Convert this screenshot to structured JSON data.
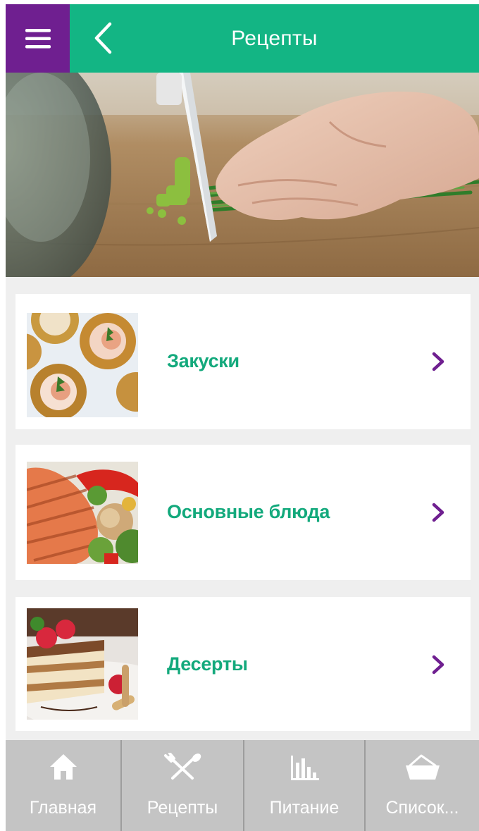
{
  "header": {
    "title": "Рецепты",
    "accent_color": "#13b584",
    "menu_color": "#6f1f90",
    "menu_icon": "hamburger-icon",
    "back_icon": "chevron-left-icon"
  },
  "categories": [
    {
      "label": "Закуски",
      "image": "appetizers-photo",
      "icon": "chevron-right-icon"
    },
    {
      "label": "Основные блюда",
      "image": "main-courses-photo",
      "icon": "chevron-right-icon"
    },
    {
      "label": "Десерты",
      "image": "desserts-photo",
      "icon": "chevron-right-icon"
    }
  ],
  "tabbar": {
    "items": [
      {
        "label": "Главная",
        "icon": "home-icon"
      },
      {
        "label": "Рецепты",
        "icon": "fork-spoon-icon"
      },
      {
        "label": "Питание",
        "icon": "bar-chart-icon"
      },
      {
        "label": "Список...",
        "icon": "basket-icon"
      }
    ]
  }
}
